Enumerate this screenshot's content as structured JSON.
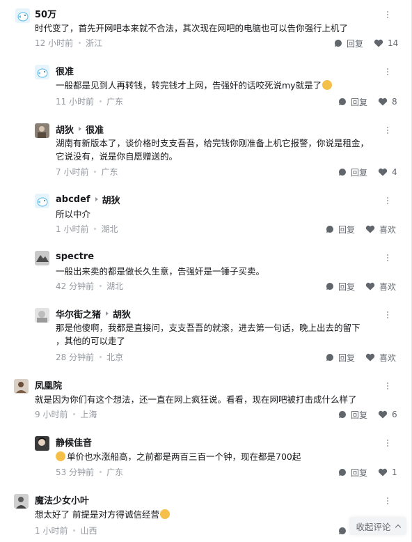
{
  "comments": [
    {
      "user": "50万",
      "text": "时代变了，首先开网吧本来就不合法，其次现在网吧的电脑也可以告你强行上机了",
      "time": "12 小时前",
      "location": "浙江",
      "reply_label": "回复",
      "likes": "14",
      "avatar": "bird-avatar"
    },
    {
      "user": "很准",
      "text": "一般都是见到人再转钱，转完钱才上网，告强奸的话咬死说my就是了",
      "time": "11 小时前",
      "location": "广东",
      "reply_label": "回复",
      "likes": "8",
      "avatar": "bird-avatar",
      "emoji": "cat-face-emoji"
    },
    {
      "user": "胡狄",
      "reply_to": "很准",
      "text_lines": [
        "湖南有新版本了，谈价格时支支吾吾，给完钱你刚准备上机它报警，你说是租金，",
        "它说没有，说是你自愿赠送的。"
      ],
      "time": "7 小时前",
      "location": "广东",
      "reply_label": "回复",
      "likes": "4",
      "avatar": "photo-avatar"
    },
    {
      "user": "abcdef",
      "reply_to": "胡狄",
      "text": "所以中介",
      "time": "1 小时前",
      "location": "湖北",
      "reply_label": "回复",
      "likes": "喜欢",
      "avatar": "bird-avatar"
    },
    {
      "user": "spectre",
      "text": "一般出来卖的都是做长久生意，告强奸是一锤子买卖。",
      "time": "42 分钟前",
      "location": "湖北",
      "reply_label": "回复",
      "likes": "喜欢",
      "avatar": "photo-avatar"
    },
    {
      "user": "华尔街之猪",
      "reply_to": "胡狄",
      "text_lines": [
        "那是他傻啊，我都是直接问，支支吾吾的就滚，进去第一句话，晚上出去的留下",
        "，其他的可以走了"
      ],
      "time": "28 分钟前",
      "location": "北京",
      "reply_label": "回复",
      "likes": "喜欢",
      "avatar": "photo-avatar"
    },
    {
      "user": "凤凰院",
      "text": "就是因为你们有这个想法，还一直在网上疯狂说。看看，现在网吧被打击成什么样了",
      "time": "9 小时前",
      "location": "上海",
      "reply_label": "回复",
      "likes": "6",
      "avatar": "photo-avatar"
    },
    {
      "user": "静候佳音",
      "text": "单价也水涨船高，之前都是两百三百一个钟，现在都是700起",
      "time": "53 分钟前",
      "location": "广东",
      "reply_label": "回复",
      "likes": "1",
      "avatar": "photo-avatar",
      "emoji": "crying-face-emoji"
    },
    {
      "user": "魔法少女小叶",
      "text": "想太好了 前提是对方得诚信经营",
      "time": "1 小时前",
      "location": "山西",
      "reply_label": "回复",
      "likes": "",
      "avatar": "photo-avatar",
      "emoji": "thinking-face-emoji"
    }
  ],
  "collapse_label": "收起评论",
  "colors": {
    "text": "#18191c",
    "meta": "#9499a0",
    "action": "#61666d",
    "bird_blue": "#6ec3ee"
  }
}
